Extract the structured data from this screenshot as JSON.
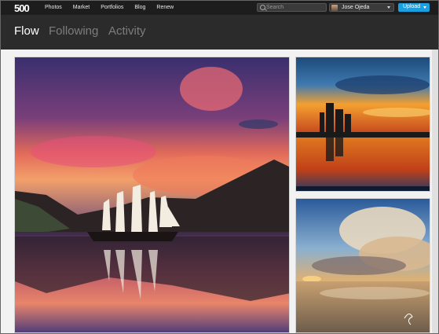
{
  "topbar": {
    "logo": "500",
    "nav": [
      "Photos",
      "Market",
      "Portfolios",
      "Blog",
      "Renew"
    ],
    "search_placeholder": "Search",
    "user_name": "Jose Ojeda",
    "upload_label": "Upload"
  },
  "tabs": [
    {
      "label": "Flow",
      "active": true
    },
    {
      "label": "Following",
      "active": false
    },
    {
      "label": "Activity",
      "active": false
    }
  ],
  "photos": [
    {
      "subject": "tall ship on mountain lake at sunset"
    },
    {
      "subject": "abbey ruins reflected at sunset"
    },
    {
      "subject": "beach under dramatic clouds"
    }
  ],
  "colors": {
    "accent": "#1a9fe0",
    "topbar": "#1d1d1d",
    "header": "#2b2b2b"
  }
}
